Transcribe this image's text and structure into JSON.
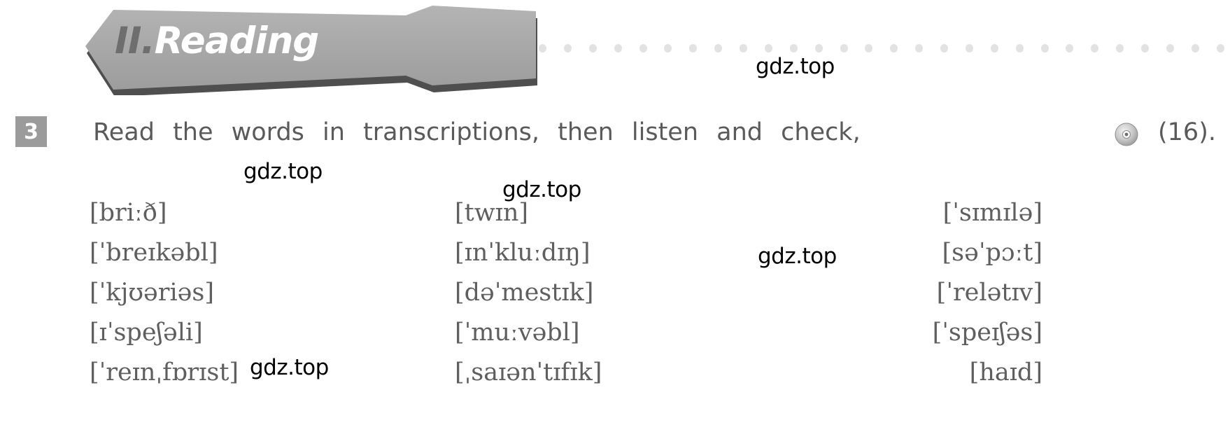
{
  "header": {
    "section_number": "II.",
    "section_title": "Reading",
    "banner_color": "#a8a8a8",
    "banner_shadow_color": "#4a4a4a",
    "number_color": "#6e6e6e",
    "title_color": "#ffffff",
    "dot_color": "#e2e2e2",
    "dot_count": 28
  },
  "task": {
    "number": "3",
    "number_box_color": "#9b9b9b",
    "instruction": "Read the words in transcriptions, then listen and check,",
    "audio_icon": "cd-disc-icon",
    "reference": "(16).",
    "text_color": "#5a5a5a"
  },
  "watermarks": [
    {
      "text": "gdz.top"
    },
    {
      "text": "gdz.top"
    },
    {
      "text": "gdz.top"
    },
    {
      "text": "gdz.top"
    },
    {
      "text": "gdz.top"
    }
  ],
  "transcriptions": {
    "column_1": [
      "[briːð]",
      "[ˈbreɪkəbl]",
      "[ˈkjʊəriəs]",
      "[ɪˈspeʃəli]",
      "[ˈreɪnˌfɒrɪst]"
    ],
    "column_2": [
      "[twɪn]",
      "[ɪnˈkluːdɪŋ]",
      "[dəˈmestɪk]",
      "[ˈmuːvəbl]",
      "[ˌsaɪənˈtɪfɪk]"
    ],
    "column_3": [
      "[ˈsɪmɪlə]",
      "[səˈpɔːt]",
      "[ˈrelətɪv]",
      "[ˈspeɪʃəs]",
      "[haɪd]"
    ]
  }
}
